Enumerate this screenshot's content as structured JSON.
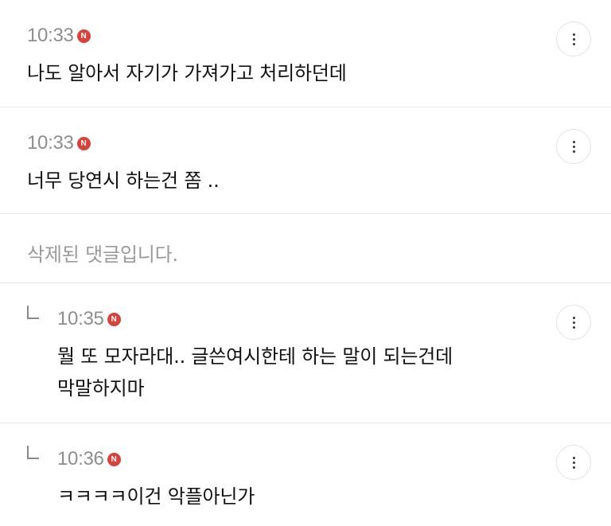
{
  "comments": [
    {
      "time": "10:33",
      "badge": "N",
      "text": "나도 알아서 자기가 가져가고 처리하던데"
    },
    {
      "time": "10:33",
      "badge": "N",
      "text": "너무 당연시 하는건 쫌 .."
    },
    {
      "deleted_text": "삭제된 댓글입니다."
    },
    {
      "time": "10:35",
      "badge": "N",
      "text_line1": "뭘 또 모자라대.. 글쓴여시한테 하는 말이 되는건데",
      "text_line2": "막말하지마"
    },
    {
      "time": "10:36",
      "badge": "N",
      "text": "ㅋㅋㅋㅋ이건 악플아닌가"
    }
  ],
  "icons": {
    "more": "more-vertical-icon",
    "reply": "reply-arrow-icon",
    "new": "new-badge-icon"
  },
  "colors": {
    "badge": "#d9423b",
    "time": "#8e8e8e",
    "deleted": "#9a9a9a",
    "divider": "#e9e9e9"
  }
}
